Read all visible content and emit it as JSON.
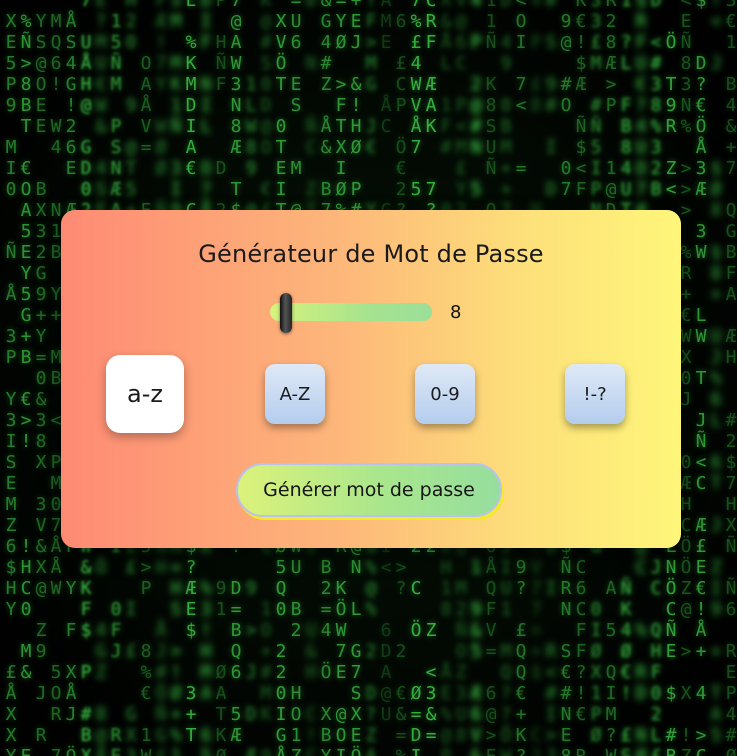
{
  "card": {
    "title": "Générateur de Mot de Passe"
  },
  "length_slider": {
    "value": 8,
    "value_label": "8"
  },
  "options": [
    {
      "label": "a-z",
      "selected": true
    },
    {
      "label": "A-Z",
      "selected": false
    },
    {
      "label": "0-9",
      "selected": false
    },
    {
      "label": "!-?",
      "selected": false
    }
  ],
  "generate_button": {
    "label": "Générer mot de passe"
  },
  "colors": {
    "card_gradient_start": "#fe8a74",
    "card_gradient_end": "#fef67a",
    "matrix_green": "#3fd14a",
    "button_gradient_start": "#dcf27a",
    "button_gradient_end": "#96de9e"
  }
}
